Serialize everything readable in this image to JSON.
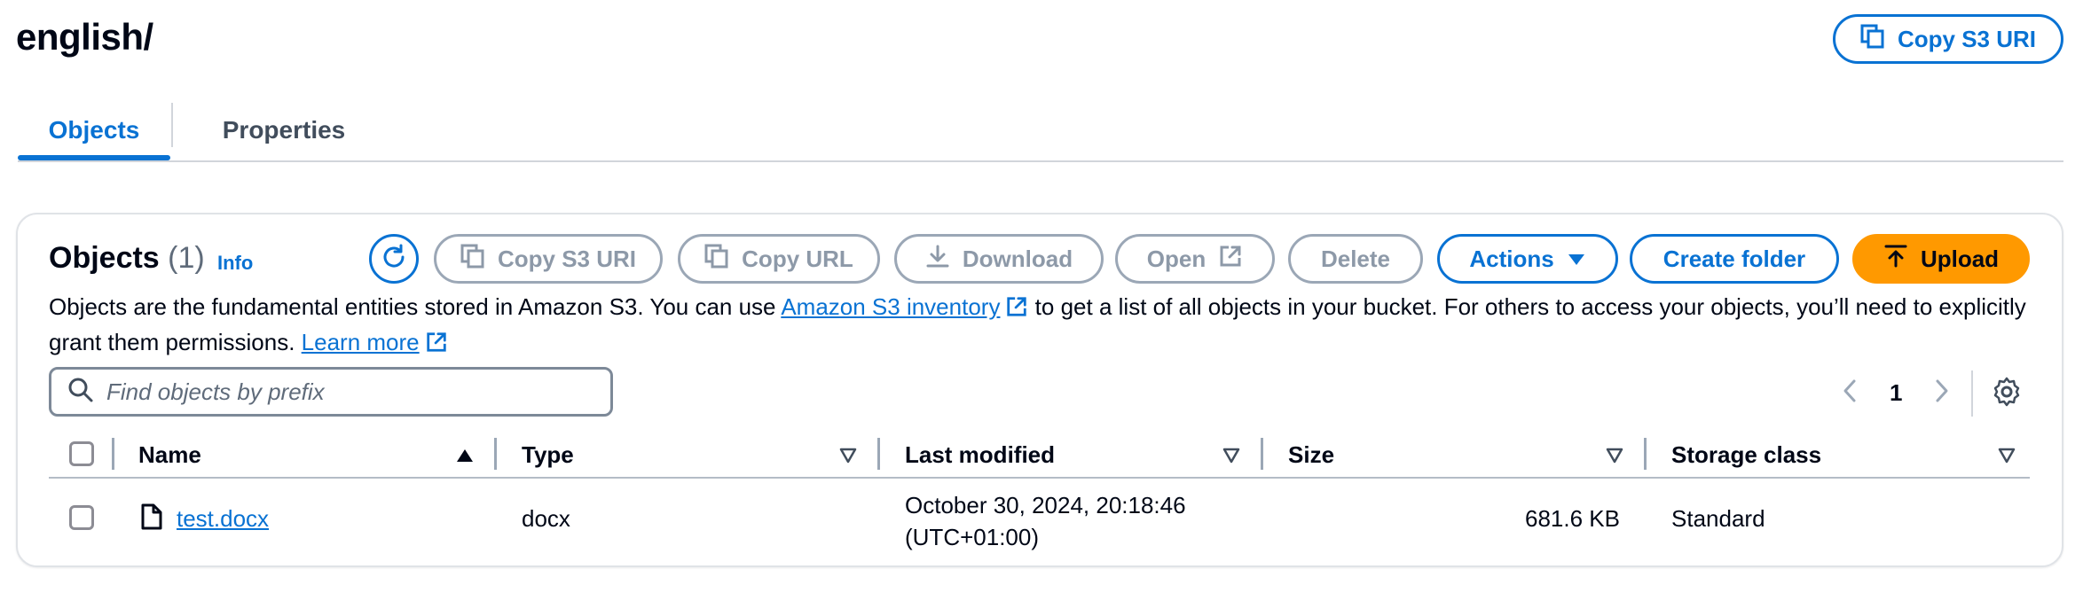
{
  "header": {
    "title": "english/",
    "copy_s3_uri_label": "Copy S3 URI"
  },
  "tabs": [
    {
      "label": "Objects",
      "active": true
    },
    {
      "label": "Properties",
      "active": false
    }
  ],
  "objects_panel": {
    "title": "Objects",
    "count": "(1)",
    "info_label": "Info",
    "buttons": {
      "copy_s3_uri": "Copy S3 URI",
      "copy_url": "Copy URL",
      "download": "Download",
      "open": "Open",
      "delete": "Delete",
      "actions": "Actions",
      "create_folder": "Create folder",
      "upload": "Upload"
    },
    "description": {
      "part1": "Objects are the fundamental entities stored in Amazon S3. You can use ",
      "link1": "Amazon S3 inventory",
      "part2": " to get a list of all objects in your bucket. For others to access your objects, you’ll need to explicitly grant them permissions. ",
      "link2": "Learn more"
    },
    "search": {
      "placeholder": "Find objects by prefix",
      "value": ""
    },
    "pagination": {
      "current_page": "1"
    },
    "table": {
      "columns": [
        "Name",
        "Type",
        "Last modified",
        "Size",
        "Storage class"
      ],
      "rows": [
        {
          "name": "test.docx",
          "type": "docx",
          "last_modified_line1": "October 30, 2024, 20:18:46",
          "last_modified_line2": "(UTC+01:00)",
          "size": "681.6 KB",
          "storage_class": "Standard"
        }
      ]
    }
  },
  "colors": {
    "accent": "#0972d3",
    "primary_button": "#ff9900",
    "disabled": "#8d99a8",
    "text": "#000716"
  }
}
